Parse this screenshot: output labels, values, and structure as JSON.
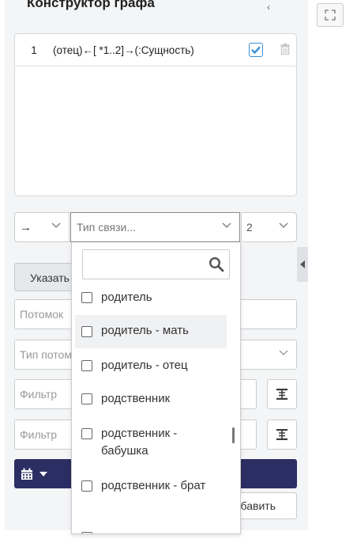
{
  "header": {
    "title": "Конструктор графа"
  },
  "query": {
    "rows": [
      {
        "num": "1",
        "expr": "(отец)←[ *1..2]→(:Сущность)",
        "checked": true
      }
    ]
  },
  "relation": {
    "direction": "→",
    "type_placeholder": "Тип связи...",
    "depth": "2"
  },
  "form": {
    "indicate_label": "Указать",
    "desc_placeholder": "Потомок",
    "type_placeholder": "Тип потомка",
    "filter1_placeholder": "Фильтр",
    "filter2_placeholder": "Фильтр",
    "add_label": "Добавить"
  },
  "dropdown": {
    "search_value": "",
    "options": [
      {
        "label": "родитель",
        "highlighted": false
      },
      {
        "label": "родитель - мать",
        "highlighted": true
      },
      {
        "label": "родитель - отец",
        "highlighted": false
      },
      {
        "label": "родственник",
        "highlighted": false
      },
      {
        "label": "родственник - бабушка",
        "highlighted": false
      },
      {
        "label": "родственник - брат",
        "highlighted": false
      }
    ]
  },
  "colors": {
    "primary": "#2b2e62",
    "check": "#3a8fd8"
  }
}
